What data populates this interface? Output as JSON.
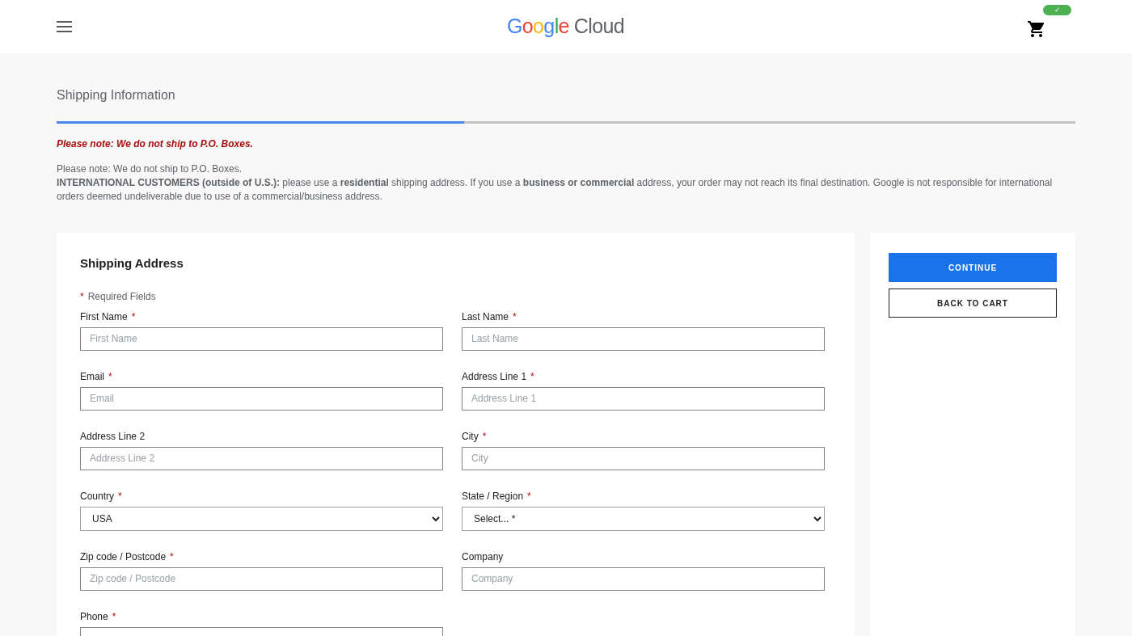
{
  "header": {
    "logo": {
      "brand": "Google",
      "product": "Cloud"
    },
    "cart_badge": "✓"
  },
  "page_title": "Shipping Information",
  "progress": {
    "level": 0.4
  },
  "notice": "Please note: We do not ship to P.O. Boxes.",
  "info": [
    "Please note: We do not ship to P.O. Boxes.",
    "**INTERNATIONAL CUSTOMERS (outside of U.S.):** please use a **residential** shipping address. If you use a **business or commercial** address, your order may not reach its final destination. Google is not responsible for international orders deemed undeliverable due to use of a commercial/business address."
  ],
  "form": {
    "title": "Shipping Address",
    "required_mark": "*",
    "required_note": "Required Fields",
    "fields": [
      {
        "label": "First Name",
        "required": true,
        "kind": "input",
        "placeholder": "First Name"
      },
      {
        "label": "Last Name",
        "required": true,
        "kind": "input",
        "placeholder": "Last Name"
      },
      {
        "label": "Email",
        "required": true,
        "kind": "input",
        "placeholder": "Email"
      },
      {
        "label": "Address Line 1",
        "required": true,
        "kind": "input",
        "placeholder": "Address Line 1"
      },
      {
        "label": "Address Line 2",
        "required": false,
        "kind": "input",
        "placeholder": "Address Line 2"
      },
      {
        "label": "City",
        "required": true,
        "kind": "input",
        "placeholder": "City"
      },
      {
        "label": "Country",
        "required": true,
        "kind": "select",
        "value": "USA"
      },
      {
        "label": "State / Region",
        "required": true,
        "kind": "select",
        "value": "Select... *"
      },
      {
        "label": "Zip code / Postcode",
        "required": true,
        "kind": "input",
        "placeholder": "Zip code / Postcode"
      },
      {
        "label": "Company",
        "required": false,
        "kind": "input",
        "placeholder": "Company"
      },
      {
        "label": "Phone",
        "required": true,
        "kind": "input"
      }
    ]
  },
  "actions": {
    "continue": "CONTINUE",
    "back": "BACK TO CART"
  }
}
